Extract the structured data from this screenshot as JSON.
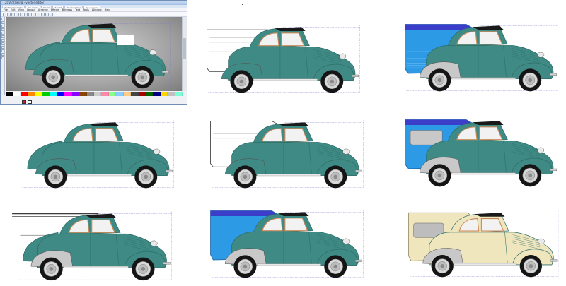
{
  "window": {
    "title": "2CV drawing - vector editor",
    "tabs": [
      "2cv fourgonnette",
      "2cv ripple",
      "2cv az",
      "2cv az",
      "2cv acadiane",
      "2cv drawing"
    ],
    "active_tab_index": 5,
    "menu": [
      "File",
      "Edit",
      "View",
      "Layout",
      "Arrange",
      "Effects",
      "Bitmaps",
      "Text",
      "Tools",
      "Window",
      "Help"
    ],
    "status": {
      "coords": "",
      "zoom": ""
    }
  },
  "palette": [
    "#000000",
    "#ffffff",
    "#ff0000",
    "#ff8800",
    "#ffff00",
    "#00cc00",
    "#00ffff",
    "#0000ff",
    "#ff00ff",
    "#8800ff",
    "#884400",
    "#888888",
    "#cccccc",
    "#ff88aa",
    "#88ff88",
    "#88ccff",
    "#ffcc88",
    "#444444",
    "#aa0000",
    "#006600",
    "#000088",
    "#ffd700",
    "#c0c0c0",
    "#7fffd4"
  ],
  "colors": {
    "body_teal": "#3f8a84",
    "body_teal_dark": "#2d6e69",
    "cream": "#efe6bd",
    "blue_light": "#2d9ae6",
    "blue_dark": "#3a3ec9",
    "fender_grey": "#c8c8c8",
    "window_glass": "#f2f2f2",
    "chrome": "#e8e8e8",
    "tire": "#151515"
  },
  "drawings": [
    {
      "variant": "editor",
      "color": "teal"
    },
    {
      "variant": "outline-van",
      "color": "teal"
    },
    {
      "variant": "blue-van-striped",
      "color": "teal"
    },
    {
      "variant": "sedan",
      "color": "teal"
    },
    {
      "variant": "outline-van-tall",
      "color": "teal"
    },
    {
      "variant": "blue-van-window",
      "color": "teal"
    },
    {
      "variant": "wireframe",
      "color": "teal"
    },
    {
      "variant": "blue-van",
      "color": "teal"
    },
    {
      "variant": "cream-van-window",
      "color": "cream"
    }
  ]
}
